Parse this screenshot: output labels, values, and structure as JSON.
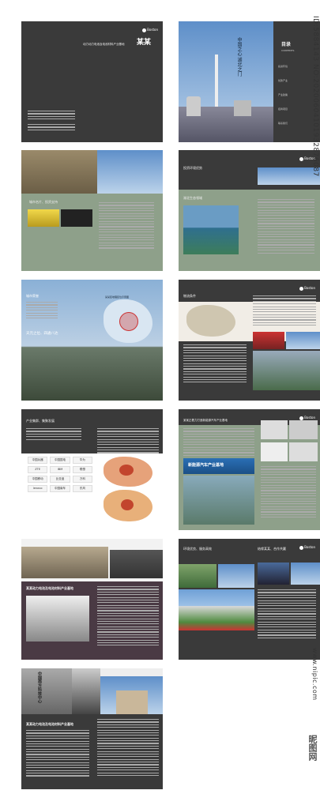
{
  "watermark": {
    "id_text": "ID:5884143 NO:20200604101932876087",
    "site": "www.nipic.com",
    "brand": "昵图网"
  },
  "cover": {
    "logo": "Boston",
    "headline": "某某",
    "subtitle": "动力动力电池及电池材料产业基地",
    "vertical_text": "中国之心 湖北之门",
    "toc_title": "目录",
    "toc_en": "CONTENTS",
    "toc_items": [
      "投资环境",
      "优势产业",
      "产业政策",
      "招商项目",
      "联系我们"
    ]
  },
  "spread2": {
    "left_heading": "城市名片、投资支持",
    "right_heading": "投资环境优势",
    "right_heading2": "湖北生态领域"
  },
  "spread3": {
    "left_heading": "城市荣誉",
    "left_heading2": "天元之位、四通八达",
    "map_title": "某某区地理区位示意图",
    "right_heading": "物流条件"
  },
  "spread4": {
    "left_heading": "产业集群、集聚发展",
    "right_heading": "某某正着力打造新能源汽车产业基地",
    "logos": [
      "中国兵器",
      "中国国电",
      "华为",
      "ZTE",
      "IBM",
      "联想",
      "中国移动",
      "比亚迪",
      "万科",
      "lenovo",
      "中国南车",
      "东风"
    ],
    "banner": "新能源汽车产业基地"
  },
  "spread5": {
    "left_heading": "某某动力电池及电池材料产业基地",
    "right_heading": "环境优良、服务高效",
    "right_heading2": "结缘某某、合作共赢"
  },
  "spread6": {
    "left_heading": "某某动力电池及电池材料产业基地",
    "sign": "中国南方科技中心"
  }
}
